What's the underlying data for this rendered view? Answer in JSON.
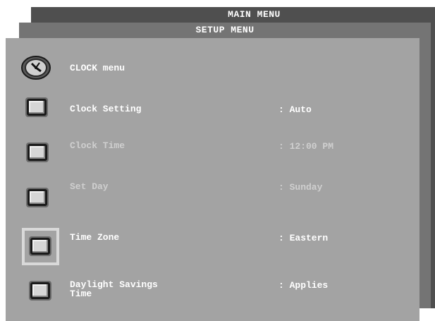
{
  "main_menu": {
    "title": "MAIN MENU"
  },
  "setup_menu": {
    "title": "SETUP MENU"
  },
  "clock_menu": {
    "title": "CLOCK menu",
    "items": [
      {
        "label": "Clock Setting",
        "value": ": Auto",
        "enabled": true
      },
      {
        "label": "Clock Time",
        "value": ": 12:00 PM",
        "enabled": false
      },
      {
        "label": "Set Day",
        "value": ": Sunday",
        "enabled": false
      },
      {
        "label": "Time Zone",
        "value": ": Eastern",
        "enabled": true,
        "focused": true
      },
      {
        "label": "Daylight Savings",
        "label_line2": "Time",
        "value": ": Applies",
        "enabled": true
      }
    ]
  },
  "colors": {
    "main_panel": "#4f4f4f",
    "setup_panel": "#747474",
    "clock_panel": "#a3a3a3",
    "focus_outline": "#d9d9d9"
  },
  "icons": {
    "clock": "clock-icon"
  }
}
